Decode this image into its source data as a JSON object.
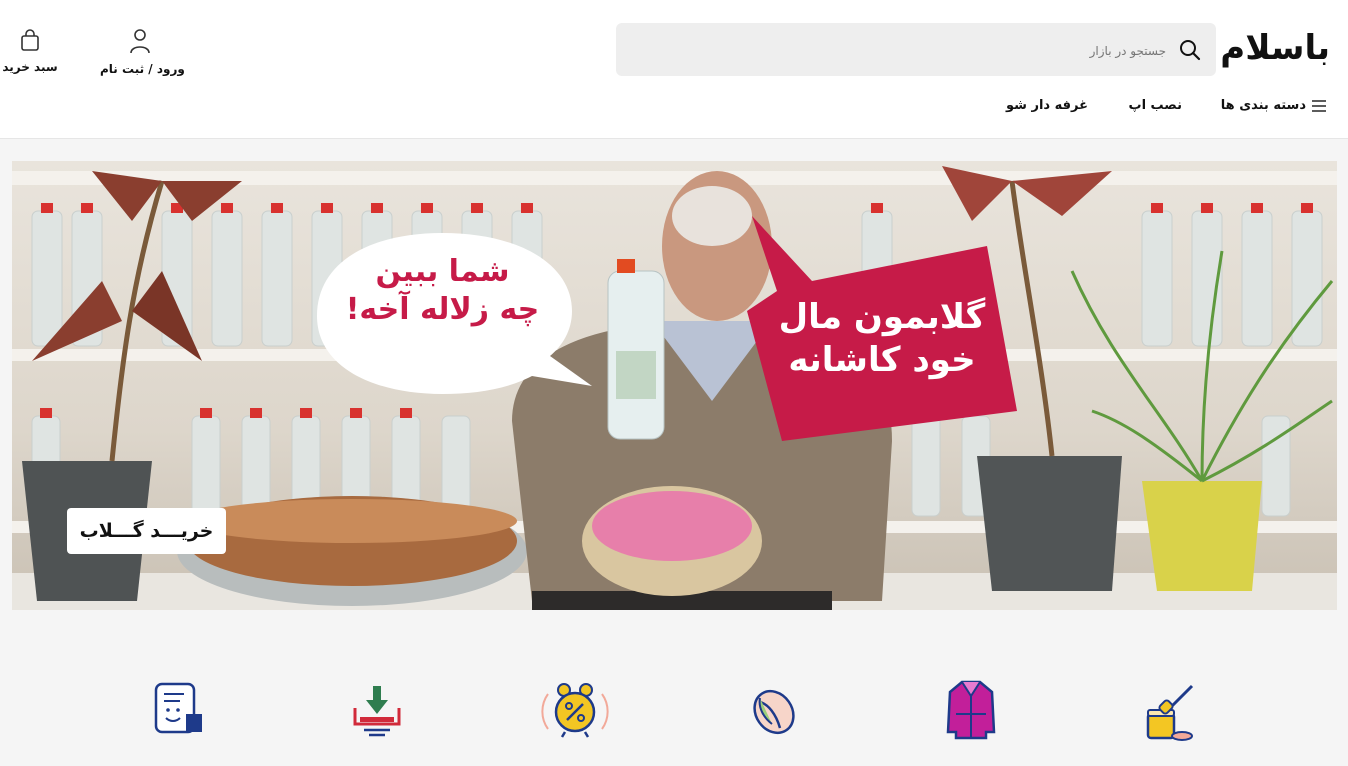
{
  "header": {
    "logo_text": "باسلام",
    "search": {
      "placeholder": "جستجو در بازار",
      "icon": "search-icon"
    },
    "login_label": "ورود / ثبت نام",
    "cart_label": "سبد خرید"
  },
  "nav": {
    "categories_label": "دسته بندی ها",
    "install_app_label": "نصب اپ",
    "booth_label": "غرفه دار شو"
  },
  "banner": {
    "bubble_left": [
      "شما ببین",
      "چه زلاله آخه!"
    ],
    "bubble_right": [
      "گلابمون مال",
      "خود کاشانه"
    ],
    "cta_label": "خریـــد گـــلاب"
  },
  "categories": [
    {
      "icon": "honey-jar-icon"
    },
    {
      "icon": "coat-icon"
    },
    {
      "icon": "pistachio-icon"
    },
    {
      "icon": "discount-alarm-clock-icon"
    },
    {
      "icon": "download-inbox-icon"
    },
    {
      "icon": "document-face-icon"
    }
  ],
  "colors": {
    "brand_red": "#c61b48",
    "accent_yellow": "#f3c623",
    "accent_blue": "#1e3a8a",
    "accent_magenta": "#c21f9a"
  }
}
